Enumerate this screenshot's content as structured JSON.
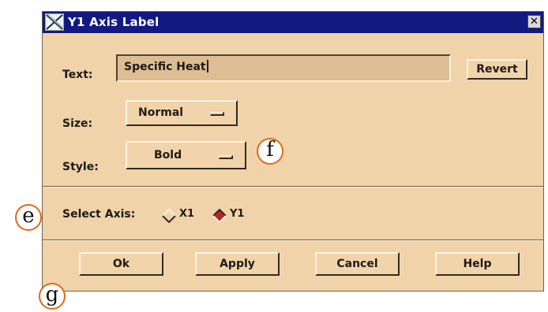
{
  "window": {
    "title": "Y1 Axis Label",
    "close_symbol": "✕"
  },
  "text_row": {
    "label": "Text:",
    "value": "Specific Heat",
    "revert_label": "Revert"
  },
  "size_row": {
    "label": "Size:",
    "selected": "Normal"
  },
  "style_row": {
    "label": "Style:",
    "selected": "Bold"
  },
  "axis_row": {
    "label": "Select Axis:",
    "options": [
      {
        "label": "X1",
        "selected": false
      },
      {
        "label": "Y1",
        "selected": true
      }
    ]
  },
  "buttons": {
    "ok": "Ok",
    "apply": "Apply",
    "cancel": "Cancel",
    "help": "Help"
  },
  "callouts": {
    "e": "e",
    "f": "f",
    "g": "g"
  },
  "colors": {
    "dialog_bg": "#f1d3a9",
    "titlebar_bg": "#12197f",
    "radio_selected": "#b8242d",
    "callout_border": "#e0691b"
  },
  "icons": {
    "title_logo": "motif-x-logo-icon",
    "close": "close-icon",
    "option_menu": "option-menu-indicator-icon",
    "radio": "diamond-radio-icon"
  }
}
